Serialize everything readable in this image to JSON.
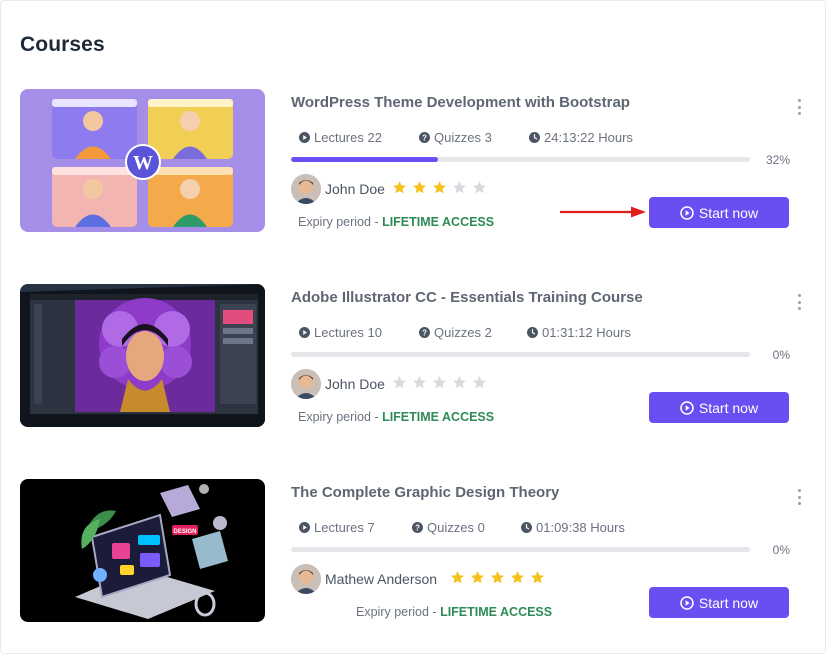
{
  "page": {
    "title": "Courses"
  },
  "colors": {
    "accent": "#6b4ef2",
    "progress": "#6c4ff4",
    "star_filled": "#f7c21e",
    "star_empty": "#d9dbe0",
    "access": "#2e8b57",
    "annotation_arrow": "#e01e1e"
  },
  "icons": {
    "lectures": "play-circle-icon",
    "quizzes": "question-circle-icon",
    "hours": "clock-icon",
    "start": "play-circle-icon",
    "menu": "kebab-menu-icon"
  },
  "courses": [
    {
      "title": "WordPress Theme Development with Bootstrap",
      "lectures": "Lectures 22",
      "quizzes": "Quizzes 3",
      "hours": "24:13:22 Hours",
      "progress": 32,
      "progress_label": "32%",
      "author": "John Doe",
      "rating": 3,
      "rating_max": 5,
      "expiry_label": "Expiry period - ",
      "expiry_value": "LIFETIME ACCESS",
      "button_label": "Start now"
    },
    {
      "title": "Adobe Illustrator CC - Essentials Training Course",
      "lectures": "Lectures 10",
      "quizzes": "Quizzes 2",
      "hours": "01:31:12 Hours",
      "progress": 0,
      "progress_label": "0%",
      "author": "John Doe",
      "rating": 0,
      "rating_max": 5,
      "expiry_label": "Expiry period - ",
      "expiry_value": "LIFETIME ACCESS",
      "button_label": "Start now"
    },
    {
      "title": "The Complete Graphic Design Theory",
      "lectures": "Lectures 7",
      "quizzes": "Quizzes 0",
      "hours": "01:09:38 Hours",
      "progress": 0,
      "progress_label": "0%",
      "author": "Mathew Anderson",
      "rating": 5,
      "rating_max": 5,
      "expiry_label": "Expiry period - ",
      "expiry_value": "LIFETIME ACCESS",
      "button_label": "Start now"
    }
  ]
}
